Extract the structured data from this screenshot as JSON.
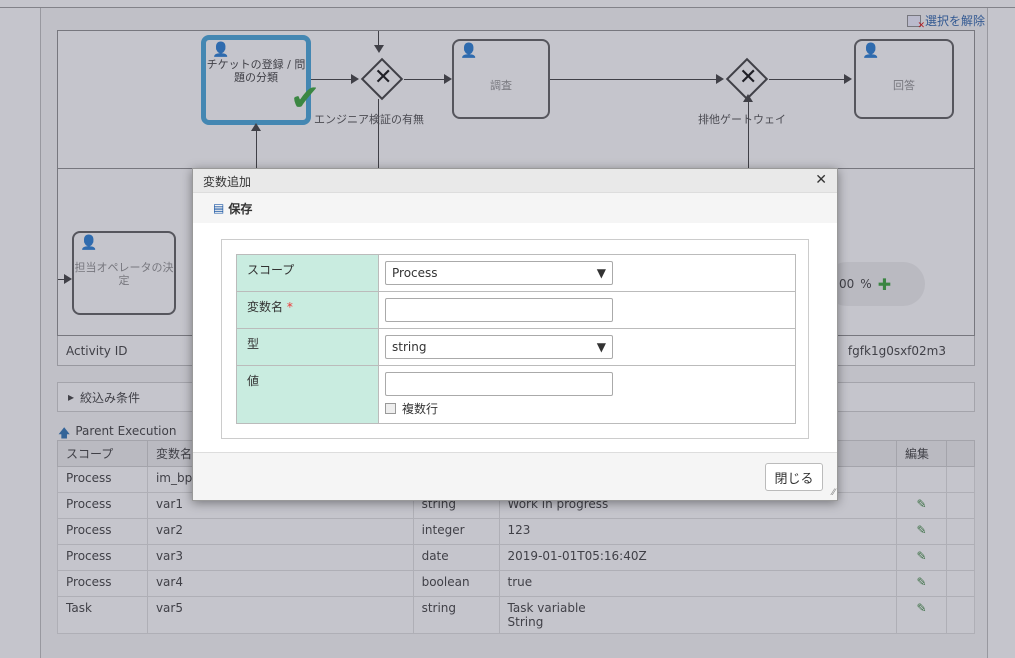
{
  "header": {
    "deselect_label": "選択を解除"
  },
  "diagram": {
    "task_ticket": "チケットの登録 / 問題の分類",
    "task_investigate": "調査",
    "task_answer": "回答",
    "task_assign": "担当オペレータの決定",
    "flow_label_engineer": "エンジニア検証の有無",
    "flow_label_gateway": "排他ゲートウェイ",
    "zoom_value": "00",
    "zoom_unit": "%"
  },
  "activity": {
    "label": "Activity ID",
    "value": "fgfk1g0sxf02m3"
  },
  "filter": {
    "label": "絞込み条件"
  },
  "parent_link": {
    "label": "Parent Execution"
  },
  "table": {
    "headers": {
      "scope": "スコープ",
      "name": "変数名",
      "edit": "編集"
    },
    "rows": [
      {
        "scope": "Process",
        "name": "im_bp",
        "type": "",
        "value": ""
      },
      {
        "scope": "Process",
        "name": "var1",
        "type": "string",
        "value": "Work in progress"
      },
      {
        "scope": "Process",
        "name": "var2",
        "type": "integer",
        "value": "123"
      },
      {
        "scope": "Process",
        "name": "var3",
        "type": "date",
        "value": "2019-01-01T05:16:40Z"
      },
      {
        "scope": "Process",
        "name": "var4",
        "type": "boolean",
        "value": "true"
      },
      {
        "scope": "Task",
        "name": "var5",
        "type": "string",
        "value": "Task variable",
        "value2": "String"
      }
    ]
  },
  "dialog": {
    "title": "変数追加",
    "save_label": "保存",
    "fields": {
      "scope_label": "スコープ",
      "scope_value": "Process",
      "name_label": "変数名",
      "name_required": "*",
      "name_value": "",
      "type_label": "型",
      "type_value": "string",
      "value_label": "値",
      "value_value": "",
      "multiline_label": "複数行"
    },
    "close_button": "閉じる"
  }
}
